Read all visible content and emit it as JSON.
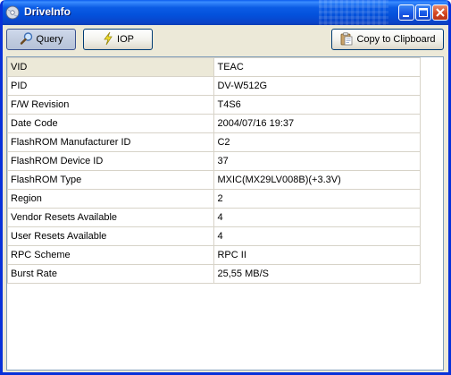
{
  "window": {
    "title": "DriveInfo",
    "app_icon": "disc-icon",
    "controls": [
      "minimize-icon",
      "maximize-icon",
      "close-icon"
    ]
  },
  "toolbar": {
    "query_label": "Query",
    "query_icon": "magnifier-icon",
    "iop_label": "IOP",
    "iop_icon": "lightning-icon",
    "copy_label": "Copy to Clipboard",
    "copy_icon": "clipboard-icon"
  },
  "info": {
    "rows": [
      {
        "name": "VID",
        "value": "TEAC"
      },
      {
        "name": "PID",
        "value": "DV-W512G"
      },
      {
        "name": "F/W Revision",
        "value": "T4S6"
      },
      {
        "name": "Date Code",
        "value": "2004/07/16 19:37"
      },
      {
        "name": "FlashROM Manufacturer ID",
        "value": "C2"
      },
      {
        "name": "FlashROM Device ID",
        "value": "37"
      },
      {
        "name": "FlashROM Type",
        "value": "MXIC(MX29LV008B)(+3.3V)"
      },
      {
        "name": "Region",
        "value": "2"
      },
      {
        "name": "Vendor Resets Available",
        "value": "4"
      },
      {
        "name": "User Resets Available",
        "value": "4"
      },
      {
        "name": "RPC Scheme",
        "value": "RPC II"
      },
      {
        "name": "Burst Rate",
        "value": "25,55 MB/S"
      }
    ]
  },
  "colors": {
    "titlebar": "#0351dc",
    "window_bg": "#ece9d8",
    "grid_line": "#d7d3c8"
  }
}
